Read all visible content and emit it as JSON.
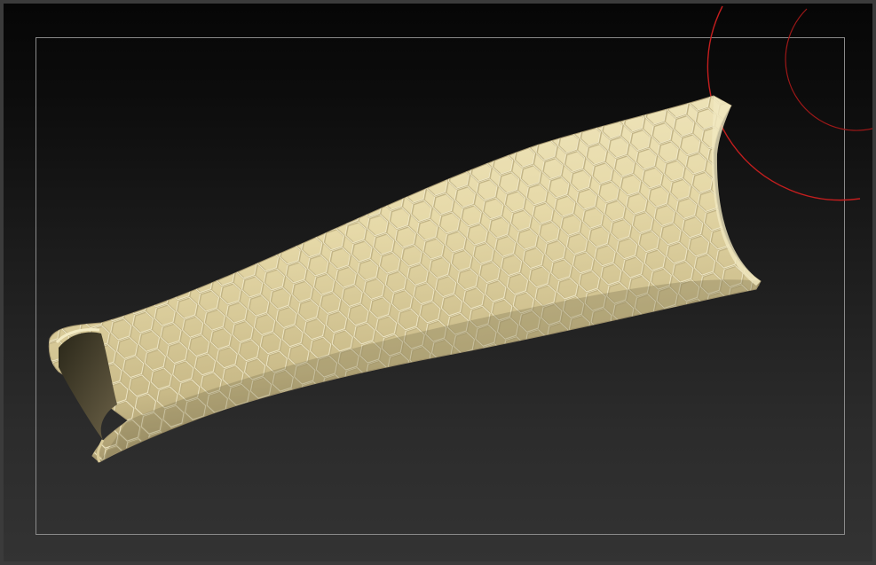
{
  "canvas": {
    "background_top": "#060606",
    "background_bottom": "#333333",
    "frame_color": "#8a8a8a"
  },
  "model": {
    "name": "honeycomb-sleeve",
    "surface_color": "#e8dcae",
    "edge_color": "#b3a579",
    "cell_shape": "hexagon"
  },
  "gizmo": {
    "icon": "rotation-gizmo-icon",
    "ring_color": "#c41e1e"
  }
}
